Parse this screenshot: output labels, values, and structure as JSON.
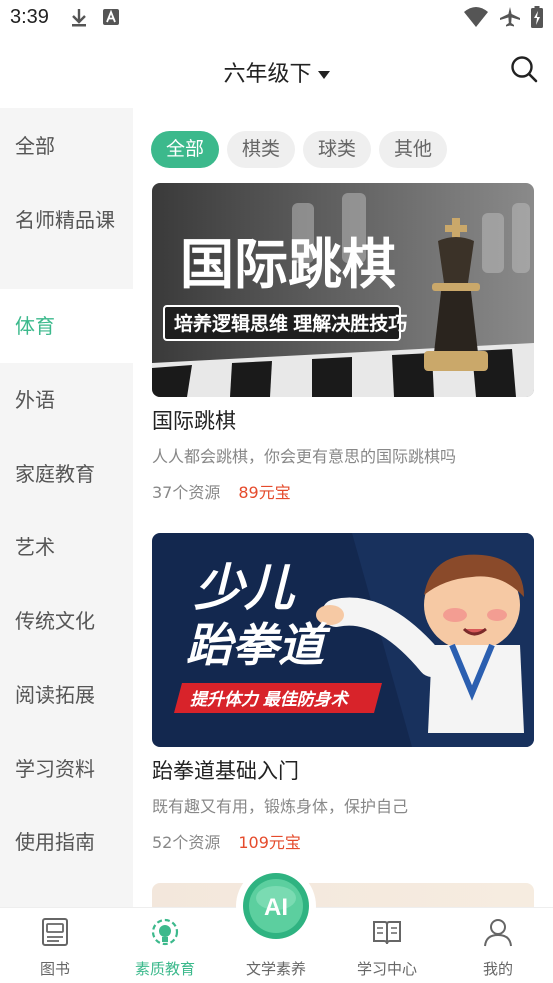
{
  "status": {
    "time": "3:39"
  },
  "header": {
    "grade": "六年级下"
  },
  "sidebar": {
    "items": [
      {
        "label": "全部"
      },
      {
        "label": "名师精品课"
      },
      {
        "label": "体育"
      },
      {
        "label": "外语"
      },
      {
        "label": "家庭教育"
      },
      {
        "label": "艺术"
      },
      {
        "label": "传统文化"
      },
      {
        "label": "阅读拓展"
      },
      {
        "label": "学习资料"
      },
      {
        "label": "使用指南"
      }
    ],
    "active_index": 2
  },
  "filters": {
    "chips": [
      {
        "label": "全部"
      },
      {
        "label": "棋类"
      },
      {
        "label": "球类"
      },
      {
        "label": "其他"
      }
    ],
    "active_index": 0
  },
  "cards": [
    {
      "banner_title": "国际跳棋",
      "banner_subtitle": "培养逻辑思维 理解决胜技巧",
      "title": "国际跳棋",
      "desc": "人人都会跳棋，你会更有意思的国际跳棋吗",
      "count": "37个资源",
      "price": "89元宝"
    },
    {
      "banner_title_line1": "少儿",
      "banner_title_line2": "跆拳道",
      "banner_subtitle": "提升体力 最佳防身术",
      "title": "跆拳道基础入门",
      "desc": "既有趣又有用，锻炼身体，保护自己",
      "count": "52个资源",
      "price": "109元宝"
    }
  ],
  "bottom_nav": {
    "items": [
      {
        "label": "图书",
        "icon": "book-icon"
      },
      {
        "label": "素质教育",
        "icon": "quality-education-icon"
      },
      {
        "label": "文学素养",
        "icon": "ai-icon"
      },
      {
        "label": "学习中心",
        "icon": "open-book-icon"
      },
      {
        "label": "我的",
        "icon": "user-icon"
      }
    ],
    "active_index": 1,
    "ai_badge": "AI"
  },
  "colors": {
    "accent": "#3cb98c",
    "price": "#e54b2c"
  }
}
